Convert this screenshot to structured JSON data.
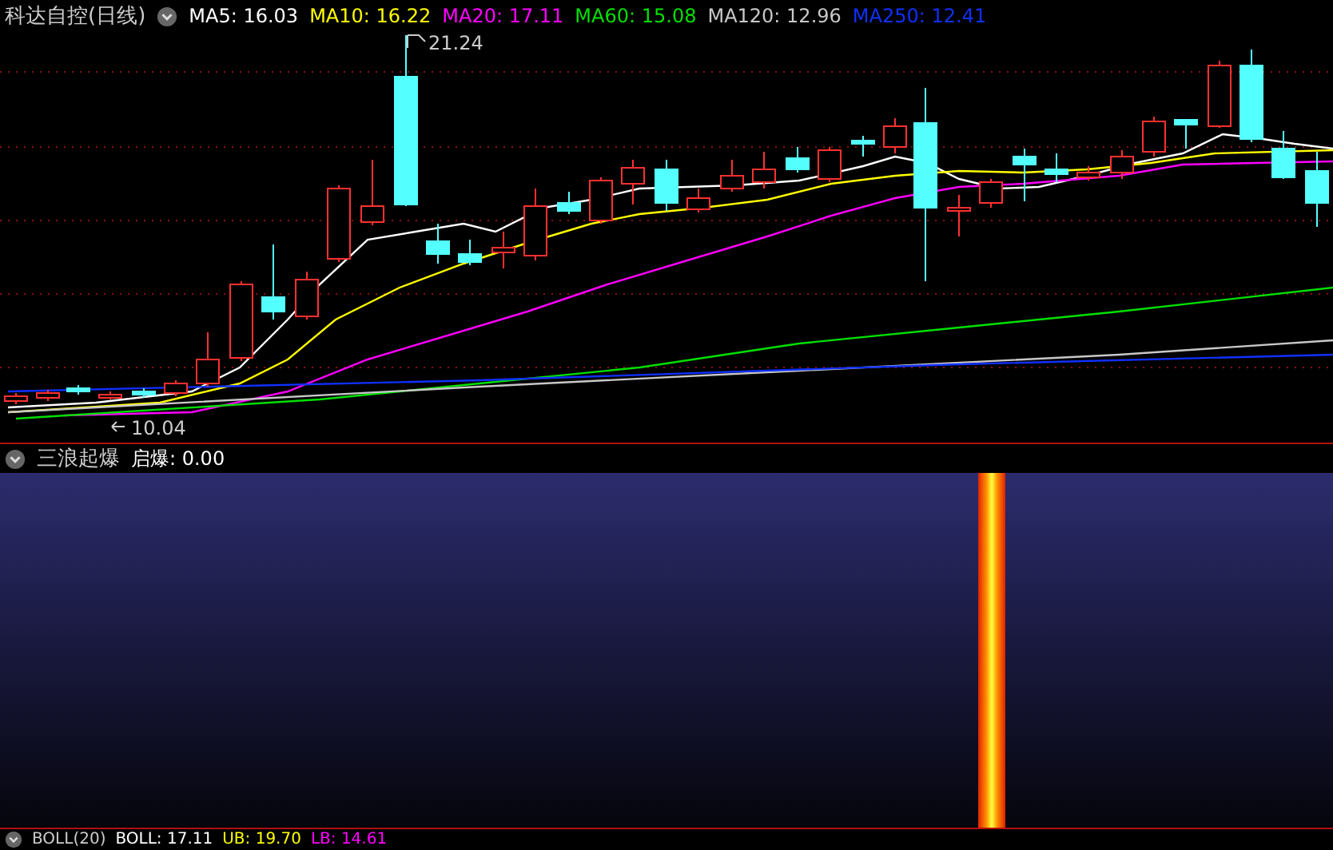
{
  "header": {
    "title": "科达自控(日线)",
    "ma": [
      {
        "label": "MA5: 16.03",
        "color": "#ffffff"
      },
      {
        "label": "MA10: 16.22",
        "color": "#ffff00"
      },
      {
        "label": "MA20: 17.11",
        "color": "#ff00ff"
      },
      {
        "label": "MA60: 15.08",
        "color": "#00e000"
      },
      {
        "label": "MA120: 12.96",
        "color": "#c8c8c8"
      },
      {
        "label": "MA250: 12.41",
        "color": "#1030ff"
      }
    ]
  },
  "price_chart": {
    "high_label": "21.24",
    "low_label": "10.04"
  },
  "indicator": {
    "title": "三浪起爆",
    "value_label": "启爆: 0.00"
  },
  "boll": {
    "title": "BOLL(20)",
    "items": [
      {
        "label": "BOLL: 17.11",
        "color": "#ffffff"
      },
      {
        "label": "UB: 19.70",
        "color": "#ffff00"
      },
      {
        "label": "LB: 14.61",
        "color": "#ff00ff"
      }
    ]
  }
}
